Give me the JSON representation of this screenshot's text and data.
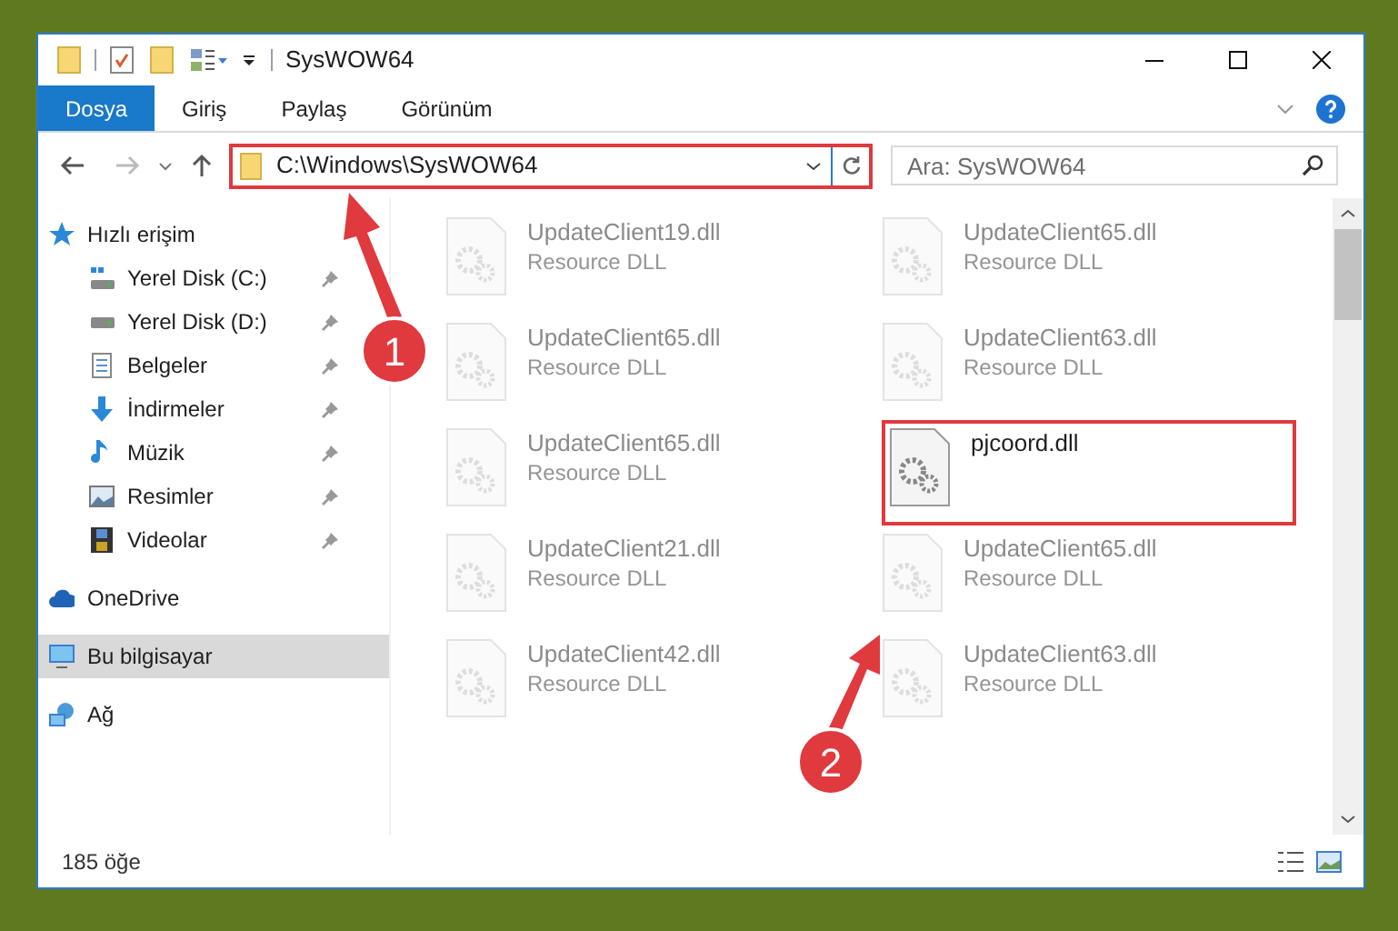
{
  "window": {
    "title": "SysWOW64"
  },
  "ribbon": {
    "tabs": [
      {
        "label": "Dosya",
        "selected": true
      },
      {
        "label": "Giriş",
        "selected": false
      },
      {
        "label": "Paylaş",
        "selected": false
      },
      {
        "label": "Görünüm",
        "selected": false
      }
    ]
  },
  "address_bar": {
    "path": "C:\\Windows\\SysWOW64"
  },
  "search": {
    "placeholder": "Ara: SysWOW64"
  },
  "sidebar": {
    "items": [
      {
        "label": "Hızlı erişim",
        "kind": "star",
        "selected": false,
        "children": [
          {
            "label": "Yerel Disk (C:)",
            "kind": "disk-c",
            "pinned": true,
            "selected": false
          },
          {
            "label": "Yerel Disk (D:)",
            "kind": "disk",
            "pinned": true,
            "selected": false
          },
          {
            "label": "Belgeler",
            "kind": "document",
            "pinned": true,
            "selected": false
          },
          {
            "label": "İndirmeler",
            "kind": "download",
            "pinned": true,
            "selected": false
          },
          {
            "label": "Müzik",
            "kind": "music",
            "pinned": true,
            "selected": false
          },
          {
            "label": "Resimler",
            "kind": "picture",
            "pinned": true,
            "selected": false
          },
          {
            "label": "Videolar",
            "kind": "video",
            "pinned": true,
            "selected": false
          }
        ]
      },
      {
        "label": "OneDrive",
        "kind": "cloud",
        "selected": false
      },
      {
        "label": "Bu bilgisayar",
        "kind": "computer",
        "selected": true
      },
      {
        "label": "Ağ",
        "kind": "network",
        "selected": false
      }
    ]
  },
  "files": [
    {
      "name": "UpdateClient19.dll",
      "type": "Resource DLL",
      "highlighted": false
    },
    {
      "name": "UpdateClient65.dll",
      "type": "Resource DLL",
      "highlighted": false
    },
    {
      "name": "UpdateClient65.dll",
      "type": "Resource DLL",
      "highlighted": false
    },
    {
      "name": "UpdateClient63.dll",
      "type": "Resource DLL",
      "highlighted": false
    },
    {
      "name": "UpdateClient65.dll",
      "type": "Resource DLL",
      "highlighted": false
    },
    {
      "name": "pjcoord.dll",
      "highlighted": true
    },
    {
      "name": "UpdateClient21.dll",
      "type": "Resource DLL",
      "highlighted": false
    },
    {
      "name": "UpdateClient65.dll",
      "type": "Resource DLL",
      "highlighted": false
    },
    {
      "name": "UpdateClient42.dll",
      "type": "Resource DLL",
      "highlighted": false
    },
    {
      "name": "UpdateClient63.dll",
      "type": "Resource DLL",
      "highlighted": false
    }
  ],
  "status_bar": {
    "item_count": "185 öğe"
  },
  "annotations": [
    {
      "number": "1"
    },
    {
      "number": "2"
    }
  ]
}
